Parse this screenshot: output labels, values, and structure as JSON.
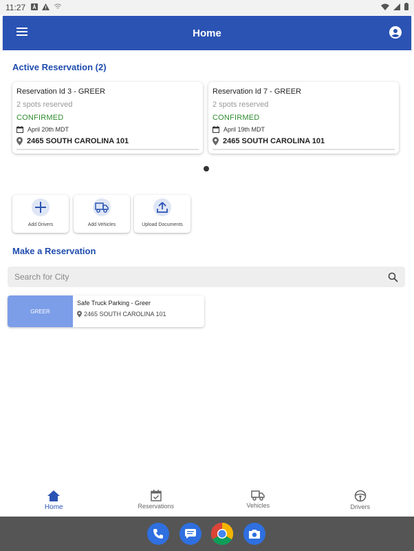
{
  "status_bar": {
    "time": "11:27"
  },
  "app_bar": {
    "title": "Home"
  },
  "active_reservation": {
    "title": "Active Reservation (2)",
    "cards": [
      {
        "title": "Reservation Id 3 - GREER",
        "spots": "2 spots reserved",
        "status": "CONFIRMED",
        "date": "April 20th MDT",
        "address": "2465 SOUTH CAROLINA 101"
      },
      {
        "title": "Reservation Id 7 - GREER",
        "spots": "2 spots reserved",
        "status": "CONFIRMED",
        "date": "April 19th MDT",
        "address": "2465 SOUTH CAROLINA 101"
      }
    ]
  },
  "actions": [
    {
      "label": "Add Drivers",
      "icon": "plus-icon"
    },
    {
      "label": "Add Vehicles",
      "icon": "truck-icon"
    },
    {
      "label": "Upload Documents",
      "icon": "upload-icon"
    }
  ],
  "make_reservation": {
    "title": "Make a Reservation",
    "search_placeholder": "Search for City",
    "results": [
      {
        "thumb_label": "GREER",
        "name": "Safe Truck Parking - Greer",
        "address": "2465 SOUTH CAROLINA 101"
      }
    ]
  },
  "bottom_nav": {
    "items": [
      {
        "label": "Home",
        "icon": "home-icon",
        "active": true
      },
      {
        "label": "Reservations",
        "icon": "calendar-check-icon",
        "active": false
      },
      {
        "label": "Vehicles",
        "icon": "truck-icon",
        "active": false
      },
      {
        "label": "Drivers",
        "icon": "steering-wheel-icon",
        "active": false
      }
    ]
  },
  "dock": [
    "phone-icon",
    "messages-icon",
    "chrome-icon",
    "camera-icon"
  ],
  "colors": {
    "primary": "#2b53b4",
    "confirmed": "#2e8b2e",
    "thumb": "#7c9de8"
  }
}
